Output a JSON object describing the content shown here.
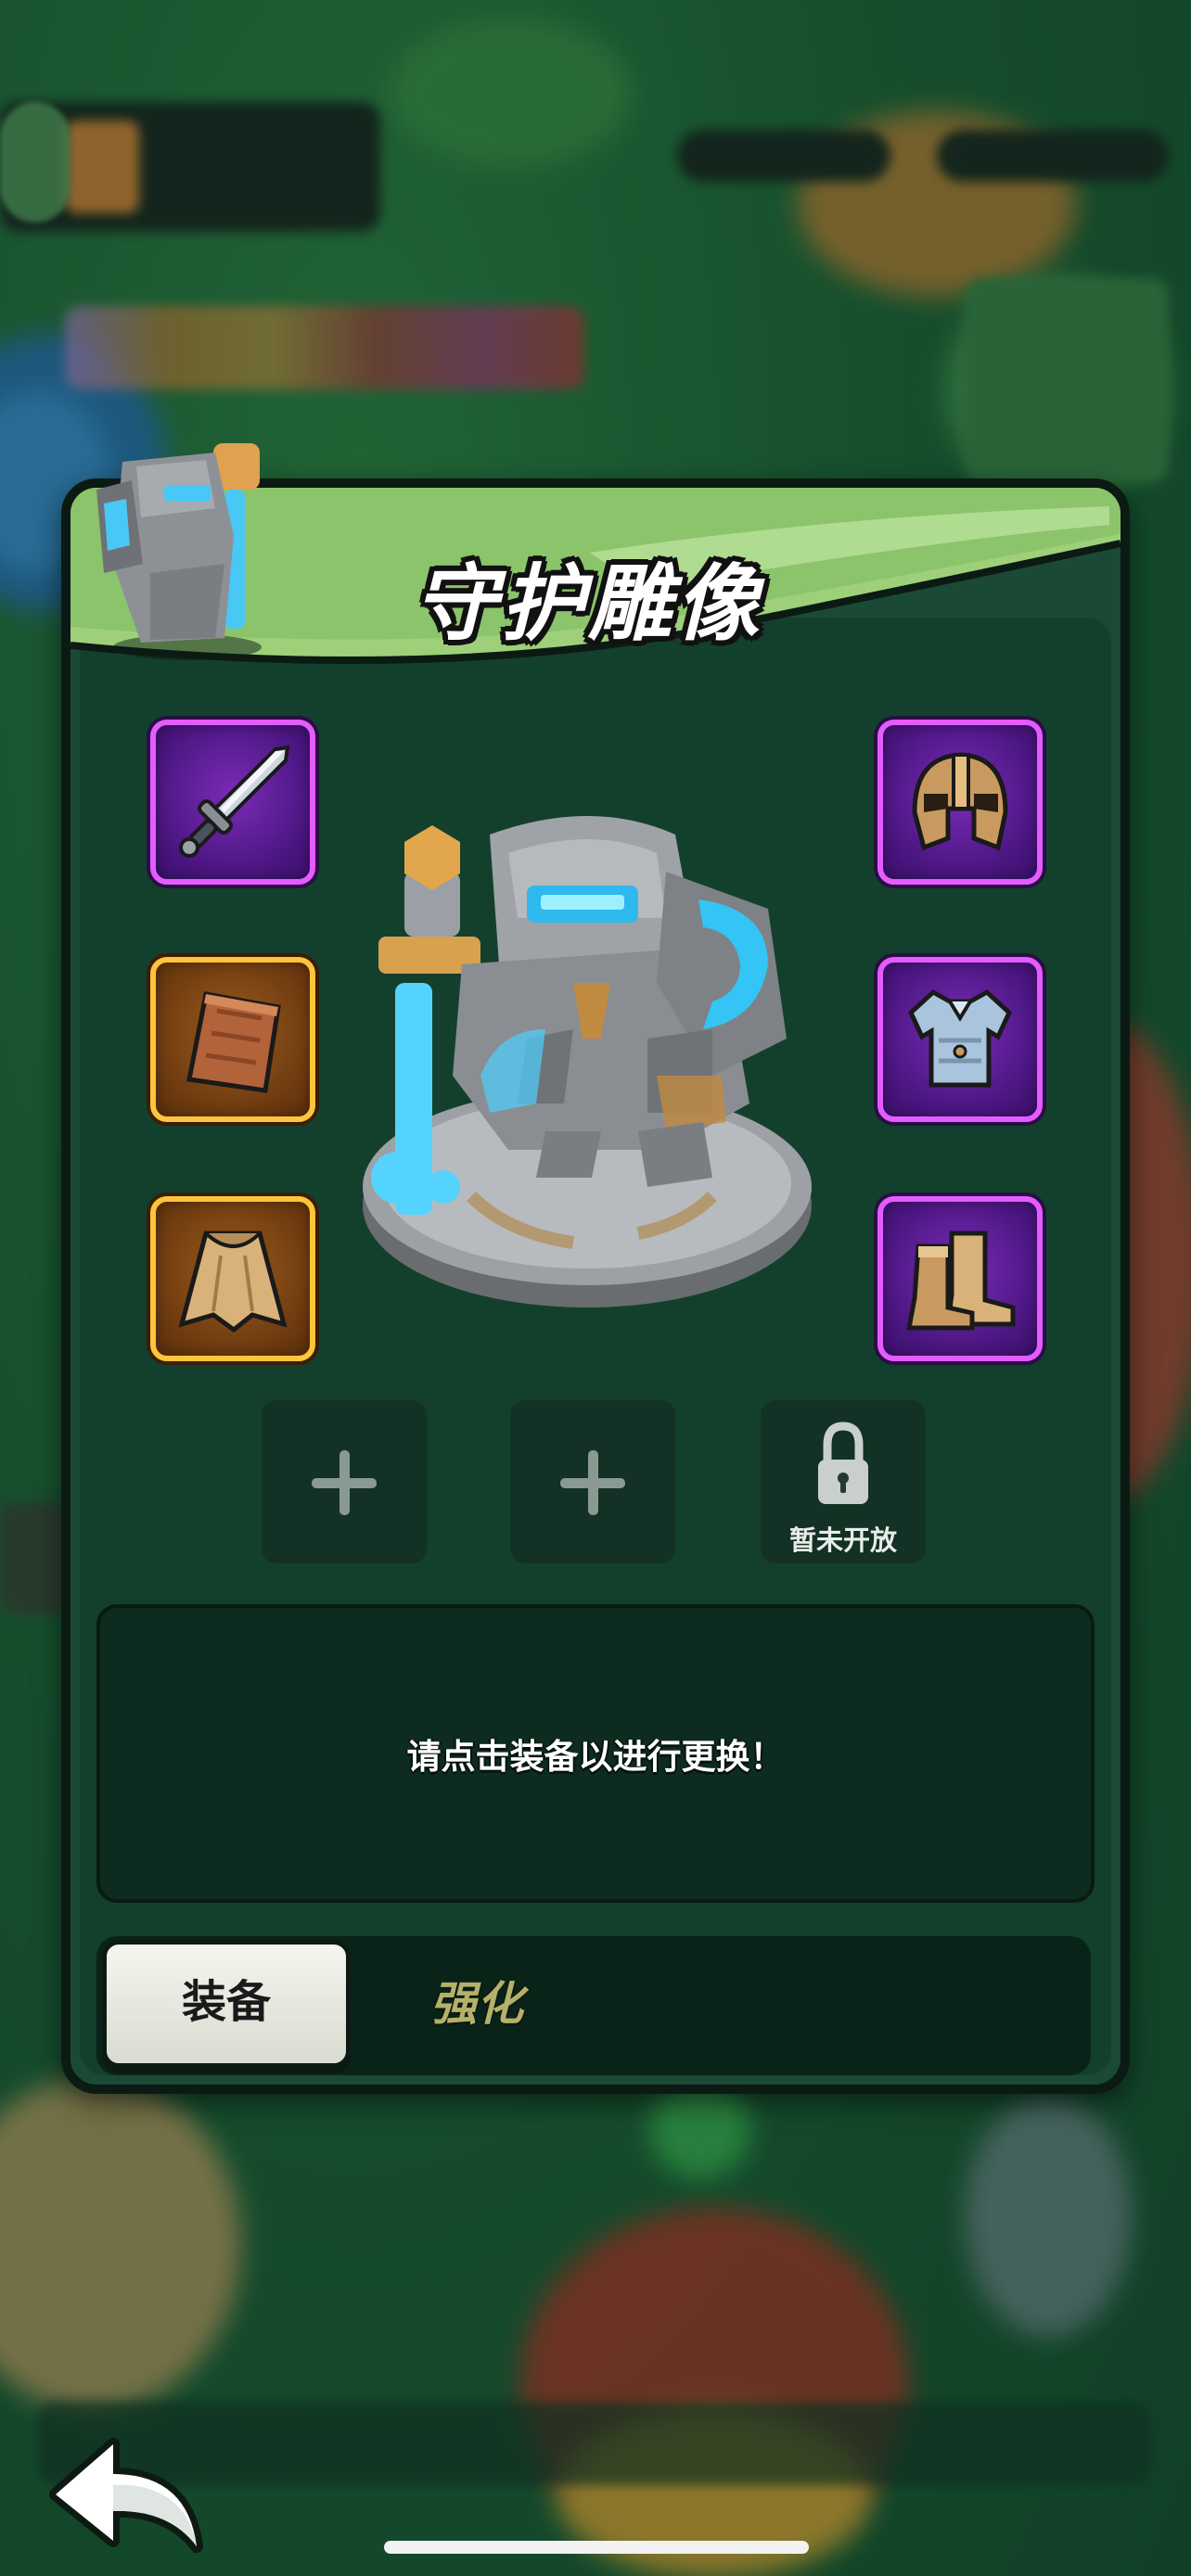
{
  "panel": {
    "title": "守护雕像",
    "hero_name_icon": "stone-golem-statue",
    "equipment_left": [
      {
        "id": "weapon",
        "icon": "sword-icon",
        "rarity": "purple"
      },
      {
        "id": "shield",
        "icon": "wooden-plank-icon",
        "rarity": "gold"
      },
      {
        "id": "cloak",
        "icon": "cloak-icon",
        "rarity": "gold"
      }
    ],
    "equipment_right": [
      {
        "id": "helmet",
        "icon": "helmet-icon",
        "rarity": "purple"
      },
      {
        "id": "armor",
        "icon": "chest-armor-icon",
        "rarity": "purple"
      },
      {
        "id": "boots",
        "icon": "boots-icon",
        "rarity": "purple"
      }
    ],
    "gem_slots": [
      {
        "state": "add"
      },
      {
        "state": "add"
      },
      {
        "state": "locked",
        "label": "暂未开放"
      }
    ],
    "message": "请点击装备以进行更换！",
    "tabs": [
      {
        "label": "装备",
        "active": true
      },
      {
        "label": "强化",
        "active": false
      }
    ]
  },
  "colors": {
    "purple_border": "#e45cff",
    "gold_border": "#ffc43a",
    "banner_green": "#8fc96b",
    "panel_bg": "#1a4a35"
  }
}
